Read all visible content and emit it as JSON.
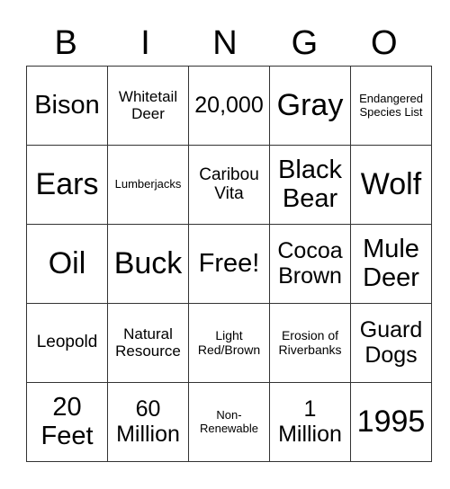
{
  "header": [
    "B",
    "I",
    "N",
    "G",
    "O"
  ],
  "rows": [
    [
      {
        "t": "Bison",
        "s": "s29"
      },
      {
        "t": "Whitetail Deer",
        "s": "s17"
      },
      {
        "t": "20,000",
        "s": "s25"
      },
      {
        "t": "Gray",
        "s": "s34"
      },
      {
        "t": "Endangered Species List",
        "s": "s13"
      }
    ],
    [
      {
        "t": "Ears",
        "s": "s34"
      },
      {
        "t": "Lumberjacks",
        "s": "s13"
      },
      {
        "t": "Caribou Vita",
        "s": "s19"
      },
      {
        "t": "Black Bear",
        "s": "s29"
      },
      {
        "t": "Wolf",
        "s": "s34"
      }
    ],
    [
      {
        "t": "Oil",
        "s": "s34"
      },
      {
        "t": "Buck",
        "s": "s34"
      },
      {
        "t": "Free!",
        "s": "s29"
      },
      {
        "t": "Cocoa Brown",
        "s": "s25"
      },
      {
        "t": "Mule Deer",
        "s": "s29"
      }
    ],
    [
      {
        "t": "Leopold",
        "s": "s19"
      },
      {
        "t": "Natural Resource",
        "s": "s17"
      },
      {
        "t": "Light Red/Brown",
        "s": "s14"
      },
      {
        "t": "Erosion of Riverbanks",
        "s": "s14"
      },
      {
        "t": "Guard Dogs",
        "s": "s25"
      }
    ],
    [
      {
        "t": "20 Feet",
        "s": "s29"
      },
      {
        "t": "60 Million",
        "s": "s25"
      },
      {
        "t": "Non-Renewable",
        "s": "s13"
      },
      {
        "t": "1 Million",
        "s": "s25"
      },
      {
        "t": "1995",
        "s": "s34"
      }
    ]
  ]
}
